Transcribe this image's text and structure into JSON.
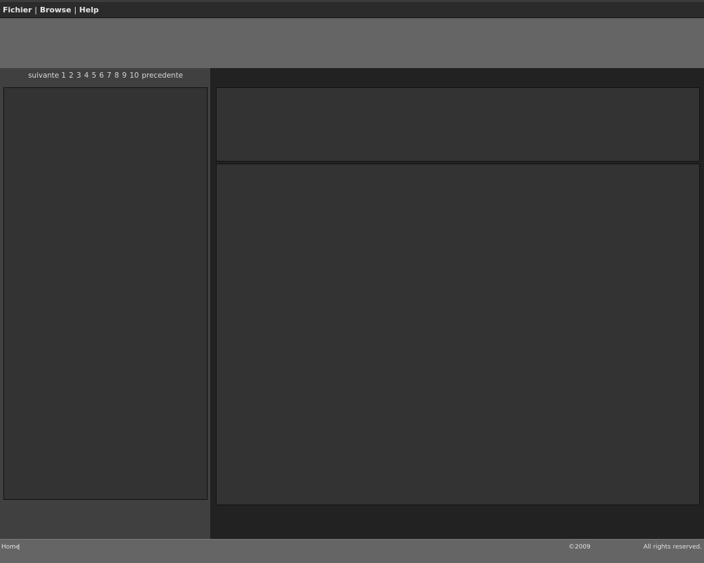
{
  "menubar": {
    "items": [
      {
        "label": "Fichier"
      },
      {
        "label": "Browse"
      },
      {
        "label": "Help"
      }
    ],
    "separator": "|"
  },
  "pagination": {
    "next_label": "suivante",
    "pages": [
      "1",
      "2",
      "3",
      "4",
      "5",
      "6",
      "7",
      "8",
      "9",
      "10"
    ],
    "prev_label": "precedente"
  },
  "footer": {
    "home_label": "Home",
    "home_separator": "|",
    "copyright": "©2009",
    "rights": "All rights reserved."
  }
}
